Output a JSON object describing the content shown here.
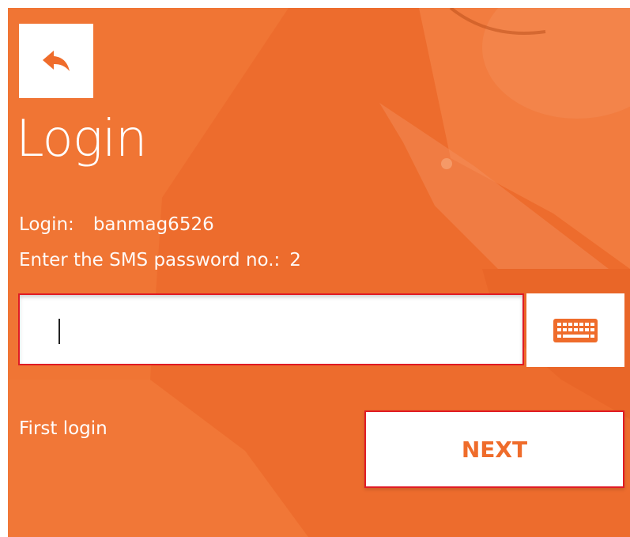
{
  "colors": {
    "background": "#f07534",
    "accent": "#ef6c2b",
    "highlight_border": "#e01b24",
    "text_light": "#ffffff"
  },
  "header": {
    "back_icon": "back-arrow-icon",
    "title": "Login"
  },
  "info": {
    "login_label": "Login:",
    "login_value": "banmag6526",
    "sms_prompt_label": "Enter the SMS password no.:",
    "sms_prompt_value": "2"
  },
  "password_input": {
    "value": "",
    "placeholder": ""
  },
  "keyboard_icon": "keyboard-icon",
  "footer": {
    "first_login_label": "First login",
    "next_label": "NEXT"
  }
}
